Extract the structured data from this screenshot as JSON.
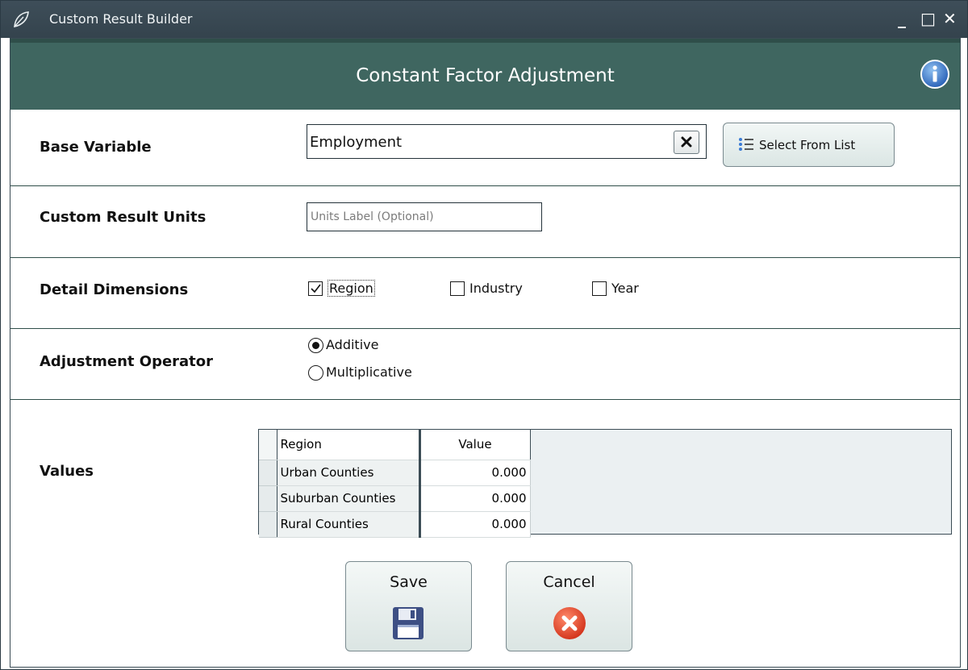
{
  "window": {
    "title": "Custom Result Builder",
    "controls": {
      "minimize": "_",
      "maximize": "□",
      "close": "✕"
    }
  },
  "header": {
    "title": "Constant Factor Adjustment",
    "info_icon": "info-icon"
  },
  "base_variable": {
    "label": "Base Variable",
    "value": "Employment",
    "select_button": "Select From List"
  },
  "custom_units": {
    "label": "Custom Result Units",
    "placeholder": "Units Label (Optional)"
  },
  "detail_dimensions": {
    "label": "Detail Dimensions",
    "options": [
      {
        "label": "Region",
        "checked": true
      },
      {
        "label": "Industry",
        "checked": false
      },
      {
        "label": "Year",
        "checked": false
      }
    ]
  },
  "adjustment_operator": {
    "label": "Adjustment Operator",
    "options": [
      {
        "label": "Additive",
        "selected": true
      },
      {
        "label": "Multiplicative",
        "selected": false
      }
    ]
  },
  "values": {
    "label": "Values",
    "columns": [
      "Region",
      "Value"
    ],
    "rows": [
      {
        "region": "Urban Counties",
        "value": "0.000"
      },
      {
        "region": "Suburban Counties",
        "value": "0.000"
      },
      {
        "region": "Rural Counties",
        "value": "0.000"
      }
    ]
  },
  "footer": {
    "save": "Save",
    "cancel": "Cancel"
  },
  "colors": {
    "header_bg": "#3f6660",
    "titlebar_bg": "#3a4a55",
    "cancel_red": "#e0432b"
  }
}
